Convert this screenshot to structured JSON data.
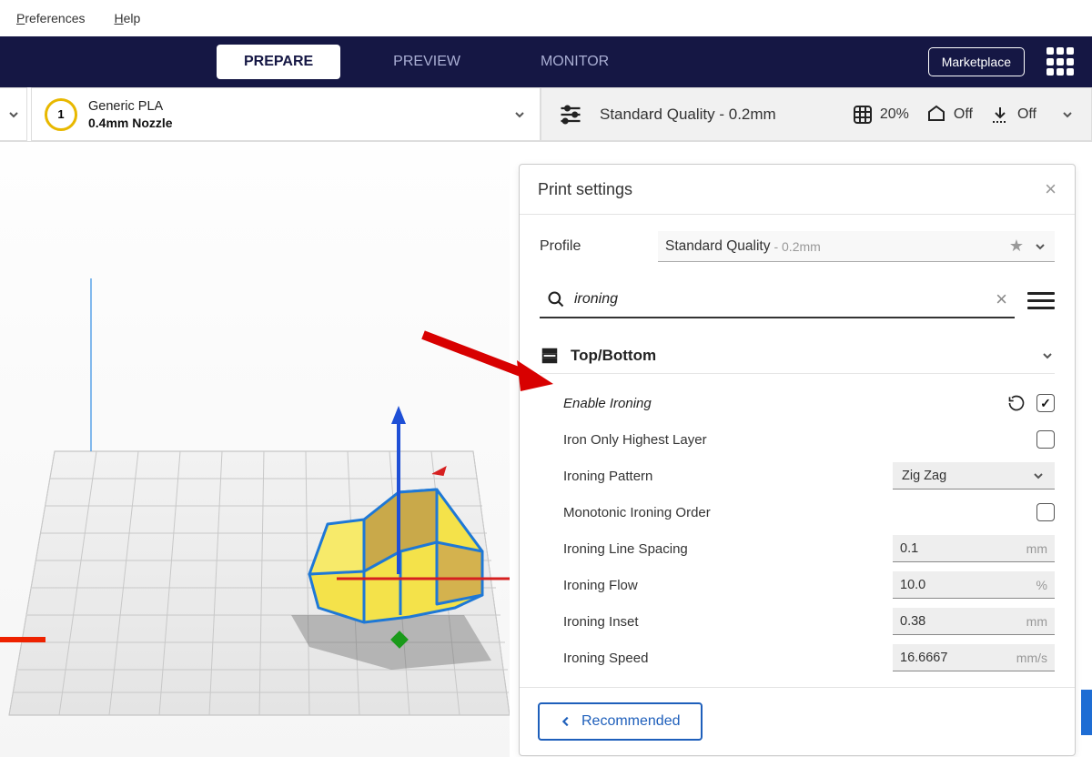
{
  "menu": {
    "preferences": "Preferences",
    "help": "Help"
  },
  "tabs": {
    "prepare": "PREPARE",
    "preview": "PREVIEW",
    "monitor": "MONITOR"
  },
  "marketplace": "Marketplace",
  "material": {
    "badge": "1",
    "name": "Generic PLA",
    "nozzle": "0.4mm Nozzle"
  },
  "profilebar": {
    "name": "Standard Quality - 0.2mm",
    "infill": "20%",
    "support": "Off",
    "adhesion": "Off"
  },
  "panel": {
    "title": "Print settings",
    "profile_label": "Profile",
    "profile_main": "Standard Quality",
    "profile_sub": "- 0.2mm",
    "search_value": "ironing",
    "section": "Top/Bottom",
    "settings": {
      "enable_ironing": "Enable Ironing",
      "iron_only_highest": "Iron Only Highest Layer",
      "ironing_pattern": "Ironing Pattern",
      "ironing_pattern_value": "Zig Zag",
      "monotonic_order": "Monotonic Ironing Order",
      "line_spacing": "Ironing Line Spacing",
      "line_spacing_value": "0.1",
      "flow": "Ironing Flow",
      "flow_value": "10.0",
      "inset": "Ironing Inset",
      "inset_value": "0.38",
      "speed": "Ironing Speed",
      "speed_value": "16.6667",
      "unit_mm": "mm",
      "unit_pct": "%",
      "unit_mms": "mm/s"
    },
    "recommended": "Recommended"
  }
}
